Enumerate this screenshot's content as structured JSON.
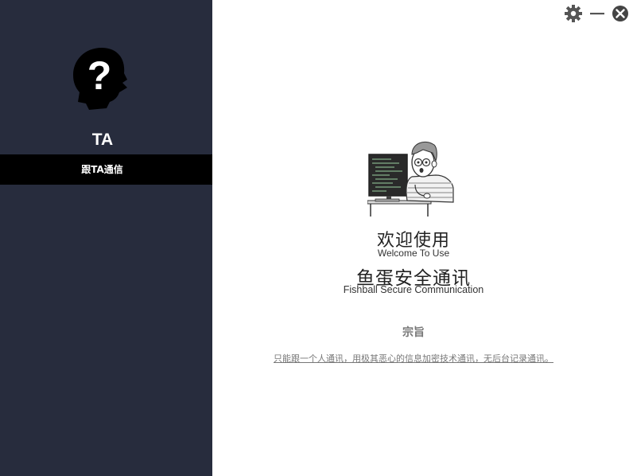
{
  "sidebar": {
    "contact_name": "TA",
    "chat_button_label": "跟TA通信",
    "avatar_icon": "unknown-person-head-icon",
    "background_color": "#272c3d"
  },
  "window_controls": {
    "settings_icon": "gear-icon",
    "minimize_icon": "minimize-icon",
    "close_icon": "close-icon"
  },
  "welcome": {
    "title_cn": "欢迎使用",
    "title_en": "Welcome To Use",
    "app_name_cn": "鱼蛋安全通讯",
    "app_name_en": "Fishball Secure Communication",
    "illustration": "programmer-at-computer-illustration"
  },
  "purpose": {
    "heading": "宗旨",
    "description": "只能跟一个人通讯，用极其恶心的信息加密技术通讯，无后台记录通讯。"
  }
}
